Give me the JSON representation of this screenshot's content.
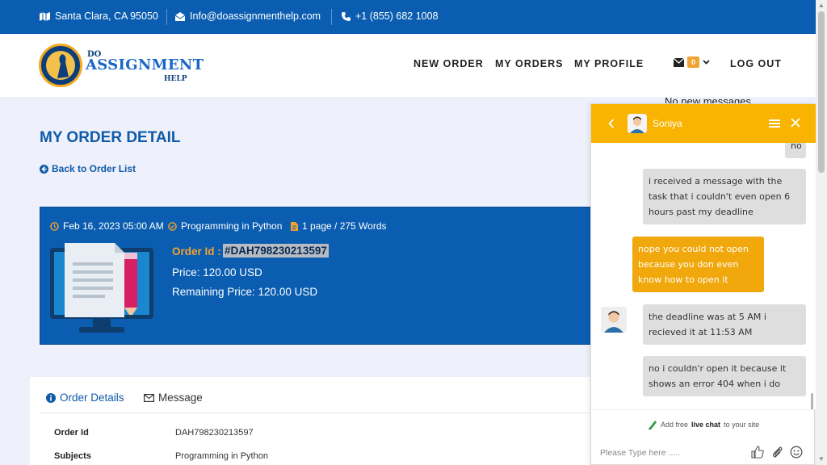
{
  "topbar": {
    "address": "Santa Clara, CA 95050",
    "email": "Info@doassignmenthelp.com",
    "phone": "+1 (855) 682 1008"
  },
  "logo": {
    "line1": "DO",
    "line2": "ASSIGNMENT",
    "line3": "HELP"
  },
  "nav": {
    "new_order": "NEW ORDER",
    "my_orders": "MY ORDERS",
    "my_profile": "MY PROFILE",
    "message_count": "0",
    "logout": "LOG OUT",
    "no_messages": "No new messages"
  },
  "page": {
    "title": "MY ORDER DETAIL",
    "back_link": "Back to Order List"
  },
  "order": {
    "date": "Feb 16, 2023 05:00 AM",
    "subject": "Programming in Python",
    "pages": "1 page / 275 Words",
    "order_id_label": "Order Id :",
    "order_id_value": "#DAH798230213597",
    "price": "Price: 120.00 USD",
    "remaining": "Remaining Price: 120.00 USD"
  },
  "details": {
    "tabs": {
      "order_details": "Order Details",
      "message": "Message"
    },
    "rows": [
      {
        "label": "Order Id",
        "value": "DAH798230213597"
      },
      {
        "label": "Subjects",
        "value": "Programming in Python"
      }
    ]
  },
  "chat": {
    "agent_name": "Soniya",
    "messages": [
      {
        "from": "user",
        "text": "no"
      },
      {
        "from": "user",
        "text": "i received a message with the task that i couldn't even open 6 hours past my deadline"
      },
      {
        "from": "agent",
        "text": "nope you could not open because you don even know how to open it"
      },
      {
        "from": "user",
        "text": "the deadline was at 5 AM i recieved it at 11:53 AM"
      },
      {
        "from": "user",
        "text": "no i couldn'r open it because it shows an error 404 when i do"
      }
    ],
    "powered_prefix": "Add free",
    "powered_bold": "live chat",
    "powered_suffix": "to your site",
    "input_placeholder": "Please Type here ....."
  },
  "colors": {
    "brand_blue": "#0a5db0",
    "accent_orange": "#f0a330",
    "chat_yellow": "#f8b400"
  }
}
